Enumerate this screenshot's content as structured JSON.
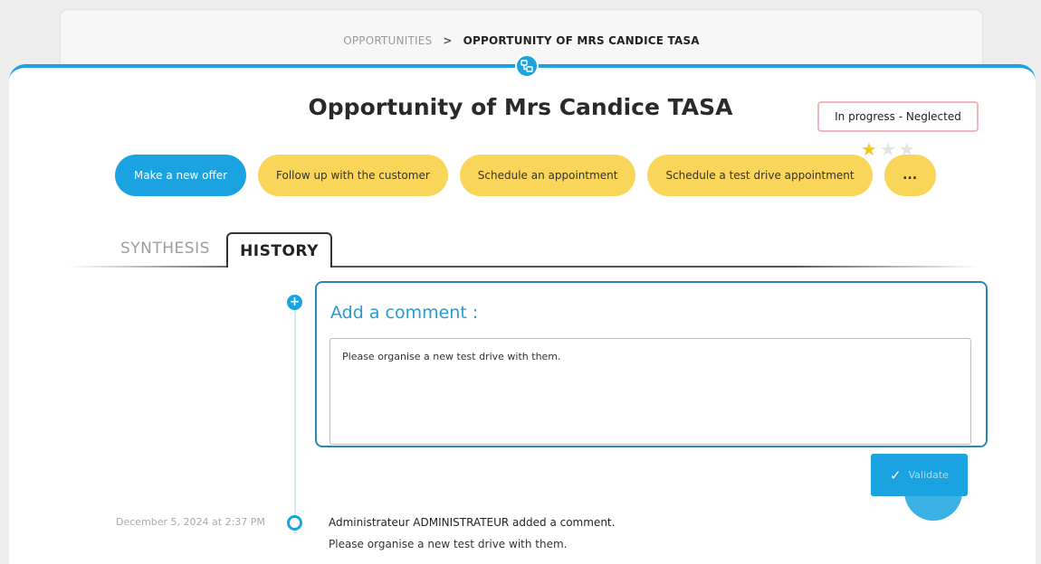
{
  "breadcrumb": {
    "parent": "OPPORTUNITIES",
    "separator": ">",
    "current": "OPPORTUNITY OF MRS CANDICE TASA"
  },
  "page": {
    "title": "Opportunity of Mrs Candice TASA",
    "status": "In progress - Neglected",
    "rating": {
      "value": 1,
      "max": 3
    }
  },
  "actions": {
    "new_offer": "Make a new offer",
    "follow_up": "Follow up with the customer",
    "appointment": "Schedule an appointment",
    "test_drive": "Schedule a test drive appointment",
    "more": "..."
  },
  "tabs": {
    "synthesis": "SYNTHESIS",
    "history": "HISTORY",
    "active": "history"
  },
  "comment": {
    "title": "Add a comment :",
    "value": "Please organise a new test drive with them.",
    "validate_label": "Validate"
  },
  "history": [
    {
      "date": "December 5, 2024 at 2:37 PM",
      "title": "Administrateur ADMINISTRATEUR added a comment.",
      "body": "Please organise a new test drive with them."
    }
  ],
  "colors": {
    "accent": "#1aa3e0",
    "action_yellow": "#f9d65a",
    "status_border": "#f0b6bd",
    "star_on": "#f5c518"
  },
  "icons": {
    "hub": "sitemap-icon",
    "star": "star-icon",
    "add": "plus-circle-icon",
    "validate": "check-icon"
  }
}
